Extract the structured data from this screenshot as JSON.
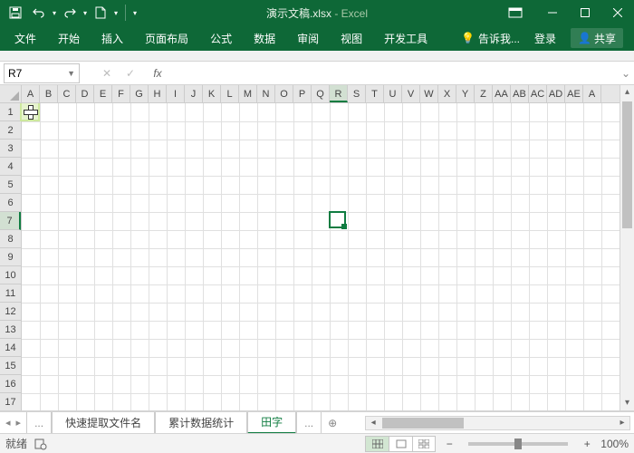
{
  "title": {
    "doc": "演示文稿.xlsx",
    "app": "Excel"
  },
  "qat": {
    "save": "保存",
    "undo": "撤销",
    "redo": "重做",
    "new": "新建"
  },
  "tabs": [
    "文件",
    "开始",
    "插入",
    "页面布局",
    "公式",
    "数据",
    "审阅",
    "视图",
    "开发工具"
  ],
  "tellme": "告诉我...",
  "account": "登录",
  "share": "共享",
  "namebox": "R7",
  "formula": "",
  "columns": [
    "A",
    "B",
    "C",
    "D",
    "E",
    "F",
    "G",
    "H",
    "I",
    "J",
    "K",
    "L",
    "M",
    "N",
    "O",
    "P",
    "Q",
    "R",
    "S",
    "T",
    "U",
    "V",
    "W",
    "X",
    "Y",
    "Z",
    "AA",
    "AB",
    "AC",
    "AD",
    "AE",
    "A"
  ],
  "rows": [
    1,
    2,
    3,
    4,
    5,
    6,
    7,
    8,
    9,
    10,
    11,
    12,
    13,
    14,
    15,
    16,
    17
  ],
  "active": {
    "col": 17,
    "row": 6
  },
  "sheets": {
    "hidden": "...",
    "items": [
      "快速提取文件名",
      "累计数据统计",
      "田字"
    ],
    "activeIndex": 2,
    "more": "..."
  },
  "status": {
    "ready": "就绪",
    "macro": "宏",
    "zoom": "100%"
  }
}
